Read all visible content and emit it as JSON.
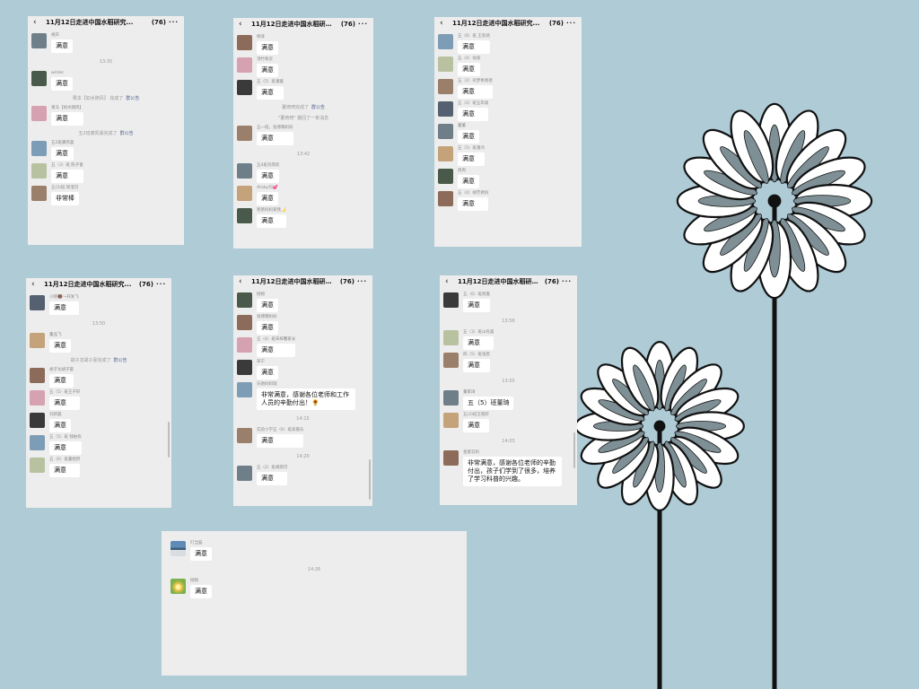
{
  "chat": {
    "title": "11月12日走进中国水稻研究...",
    "count": "(76)"
  },
  "screens": [
    {
      "items": [
        {
          "k": "msg",
          "name": "胡庆",
          "text": "满意"
        },
        {
          "k": "time",
          "text": "13:35"
        },
        {
          "k": "msg",
          "name": "winter",
          "text": "满意"
        },
        {
          "k": "sys",
          "text": "果冻【如水随风】 完成了",
          "link": "群公告"
        },
        {
          "k": "msg",
          "name": "果冻【如水随风】",
          "text": "满意"
        },
        {
          "k": "sys",
          "text": "五2班康凯晨完成了",
          "link": "群公告"
        },
        {
          "k": "msg",
          "name": "五2班康凯晨",
          "text": "满意"
        },
        {
          "k": "msg",
          "name": "五（3）班 陈子俊",
          "text": "满意"
        },
        {
          "k": "msg",
          "name": "五(3)班 邱澄可",
          "text": "非常棒"
        }
      ]
    },
    {
      "items": [
        {
          "k": "msg",
          "name": "杨泽",
          "text": "满意"
        },
        {
          "k": "msg",
          "name": "顶竹和灵",
          "text": "满意"
        },
        {
          "k": "msg",
          "name": "五（5）班潘璇",
          "text": "满意"
        },
        {
          "k": "sys",
          "text": "董琦琦完成了",
          "link": "群公告"
        },
        {
          "k": "sys",
          "text": "\"董琦琦\" 撤回了一条消息",
          "link": ""
        },
        {
          "k": "msg",
          "name": "五一班，张博霖妈妈",
          "text": "满意"
        },
        {
          "k": "time",
          "text": "13:42"
        },
        {
          "k": "msg",
          "name": "五4班刘雨欣",
          "text": "满意"
        },
        {
          "k": "msg",
          "name": "Alisby玛💕",
          "text": "满意"
        },
        {
          "k": "msg",
          "name": "爸爸妈妈爱我🌙",
          "text": "满意"
        }
      ]
    },
    {
      "items": [
        {
          "k": "msg",
          "name": "五（6）班 王思涵",
          "text": "满意"
        },
        {
          "k": "msg",
          "name": "五（4）徐某",
          "text": "满意"
        },
        {
          "k": "msg",
          "name": "五（2）孙梦希爸爸",
          "text": "满意"
        },
        {
          "k": "msg",
          "name": "五（2）班五年级",
          "text": "满意"
        },
        {
          "k": "msg",
          "name": "董董",
          "text": "满意"
        },
        {
          "k": "msg",
          "name": "五（5）班潘鸿",
          "text": "满意"
        },
        {
          "k": "msg",
          "name": "周周",
          "text": "满意"
        },
        {
          "k": "msg",
          "name": "五（4）胡芳君妈",
          "text": "满意"
        }
      ]
    },
    {
      "items": [
        {
          "k": "msg",
          "name": "小晓🐻～开发飞",
          "text": "满意"
        },
        {
          "k": "time",
          "text": "13:50"
        },
        {
          "k": "msg",
          "name": "董品飞",
          "text": "满意"
        },
        {
          "k": "sys",
          "text": "胡子龙胡子豪完成了",
          "link": "群公告"
        },
        {
          "k": "msg",
          "name": "胡子龙胡子豪",
          "text": "满意"
        },
        {
          "k": "msg",
          "name": "五（5）班王子轩",
          "text": "满意"
        },
        {
          "k": "msg",
          "name": "刘新晨",
          "text": "满意"
        },
        {
          "k": "msg",
          "name": "五（5）班 钱柏栋",
          "text": "满意"
        },
        {
          "k": "msg",
          "name": "五（6）班董相然",
          "text": "满意"
        }
      ]
    },
    {
      "items": [
        {
          "k": "msg",
          "name": "栩栩",
          "text": "满意"
        },
        {
          "k": "msg",
          "name": "张博霖妈妈",
          "text": "满意"
        },
        {
          "k": "msg",
          "name": "五（4）班宋梓馨家长",
          "text": "满意"
        },
        {
          "k": "msg",
          "name": "宋宁",
          "text": "满意"
        },
        {
          "k": "msg",
          "name": "乐驰妈妈瑞",
          "text": "非常满意，感谢各位老师和工作人员的辛勤付出！🌻"
        },
        {
          "k": "time",
          "text": "14:15"
        },
        {
          "k": "msg",
          "name": "实验小学五（6）班高嘉乐",
          "text": "满意"
        },
        {
          "k": "time",
          "text": "14:20"
        },
        {
          "k": "msg",
          "name": "五（2）班胡雨可",
          "text": "满意"
        }
      ]
    },
    {
      "items": [
        {
          "k": "msg",
          "name": "五（6）班周嘉",
          "text": "满意"
        },
        {
          "k": "time",
          "text": "13:56"
        },
        {
          "k": "msg",
          "name": "五（3）班山有喜",
          "text": "满意"
        },
        {
          "k": "msg",
          "name": "四（5）班张宸",
          "text": "满意"
        },
        {
          "k": "time",
          "text": "13:55"
        },
        {
          "k": "msg",
          "name": "董家琦",
          "text": "五（5）班董琦"
        },
        {
          "k": "msg",
          "name": "五(3)班王铭轩",
          "text": "满意"
        },
        {
          "k": "time",
          "text": "14:03"
        },
        {
          "k": "msg",
          "name": "金紫云妈",
          "text": "非常满意，感谢各位老师的辛勤付出，孩子们学到了很多，培养了学习科普的兴趣。"
        }
      ]
    },
    {
      "items": [
        {
          "k": "msg",
          "name": "叮当猫",
          "text": "满意"
        },
        {
          "k": "time",
          "text": "14:26"
        },
        {
          "k": "msg",
          "name": "栩栩",
          "text": "满意"
        }
      ]
    }
  ],
  "colors": {
    "background": "#aecbd6",
    "chat_bg": "#ededed",
    "bubble": "#ffffff",
    "link": "#576b95",
    "flower_petal": "#ffffff",
    "flower_stroke": "#111111",
    "flower_vein": "#7e9096"
  },
  "icons": {
    "back": "chevron-left-icon",
    "more": "more-dots-icon"
  }
}
